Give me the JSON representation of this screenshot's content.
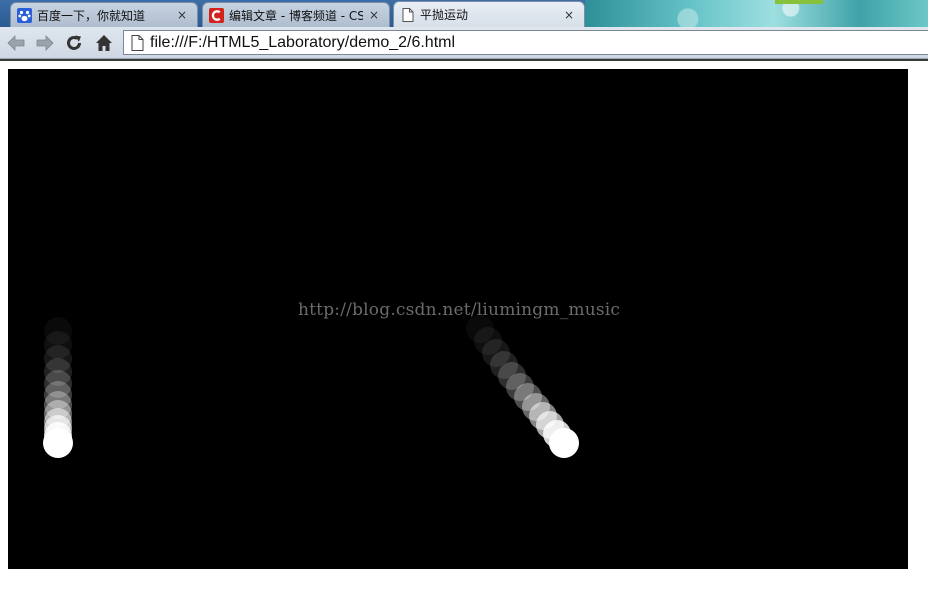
{
  "browser": {
    "tabs": [
      {
        "title": "百度一下，你就知道",
        "favicon": "baidu-paw-icon",
        "state": "inactive",
        "close": "×"
      },
      {
        "title": "编辑文章 - 博客频道 - CS",
        "favicon": "csdn-c-icon",
        "state": "inactive",
        "close": "×"
      },
      {
        "title": "平抛运动",
        "favicon": "page-icon",
        "state": "active",
        "close": "×"
      }
    ],
    "address": {
      "url": "file:///F:/HTML5_Laboratory/demo_2/6.html"
    },
    "nav_icons": [
      "back-arrow-icon",
      "forward-arrow-icon",
      "reload-icon",
      "home-icon"
    ]
  },
  "page": {
    "watermark": "http://blog.csdn.net/liumingm_music",
    "colors": {
      "canvas_background": "#000000",
      "ball": "#ffffff",
      "page_background": "#ffffff"
    },
    "balls": [
      {
        "name": "vertical-fall-ball",
        "trail": "vertical"
      },
      {
        "name": "projectile-ball",
        "trail": "diagonal"
      }
    ]
  }
}
